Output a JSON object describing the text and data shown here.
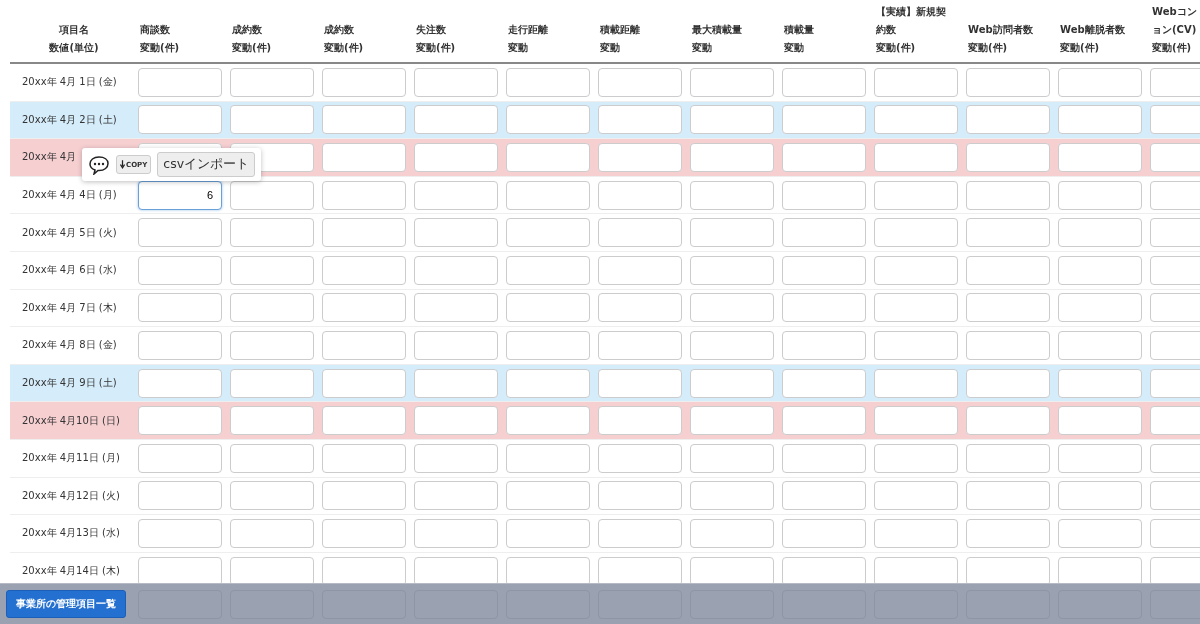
{
  "columns": [
    {
      "lines": [
        "項目名",
        "数値(単位)"
      ]
    },
    {
      "lines": [
        "商談数",
        "変動(件)"
      ]
    },
    {
      "lines": [
        "成約数",
        "変動(件)"
      ]
    },
    {
      "lines": [
        "成約数",
        "変動(件)"
      ]
    },
    {
      "lines": [
        "失注数",
        "変動(件)"
      ]
    },
    {
      "lines": [
        "走行距離",
        "変動"
      ]
    },
    {
      "lines": [
        "積載距離",
        "変動"
      ]
    },
    {
      "lines": [
        "最大積載量",
        "変動"
      ]
    },
    {
      "lines": [
        "積載量",
        "変動"
      ]
    },
    {
      "lines": [
        "【実績】新規契",
        "約数",
        "変動(件)"
      ]
    },
    {
      "lines": [
        "Web訪問者数",
        "変動(件)"
      ]
    },
    {
      "lines": [
        "Web離脱者数",
        "変動(件)"
      ]
    },
    {
      "lines": [
        "Webコン",
        "ョン(CV)",
        "変動(件)"
      ]
    }
  ],
  "rows": [
    {
      "label": "20xx年 4月 1日 (金)",
      "kind": "weekday"
    },
    {
      "label": "20xx年 4月 2日 (土)",
      "kind": "saturday"
    },
    {
      "label": "20xx年 4月",
      "kind": "sunday"
    },
    {
      "label": "20xx年 4月 4日 (月)",
      "kind": "weekday",
      "values": [
        "6"
      ],
      "focused": true
    },
    {
      "label": "20xx年 4月 5日 (火)",
      "kind": "weekday"
    },
    {
      "label": "20xx年 4月 6日 (水)",
      "kind": "weekday"
    },
    {
      "label": "20xx年 4月 7日 (木)",
      "kind": "weekday"
    },
    {
      "label": "20xx年 4月 8日 (金)",
      "kind": "weekday"
    },
    {
      "label": "20xx年 4月 9日 (土)",
      "kind": "saturday"
    },
    {
      "label": "20xx年 4月10日 (日)",
      "kind": "sunday"
    },
    {
      "label": "20xx年 4月11日 (月)",
      "kind": "weekday"
    },
    {
      "label": "20xx年 4月12日 (火)",
      "kind": "weekday"
    },
    {
      "label": "20xx年 4月13日 (水)",
      "kind": "weekday"
    },
    {
      "label": "20xx年 4月14日 (木)",
      "kind": "weekday"
    }
  ],
  "popup": {
    "copy_button": "COPY",
    "import_button": "csvインポート"
  },
  "footer": {
    "button": "事業所の管理項目一覧"
  }
}
